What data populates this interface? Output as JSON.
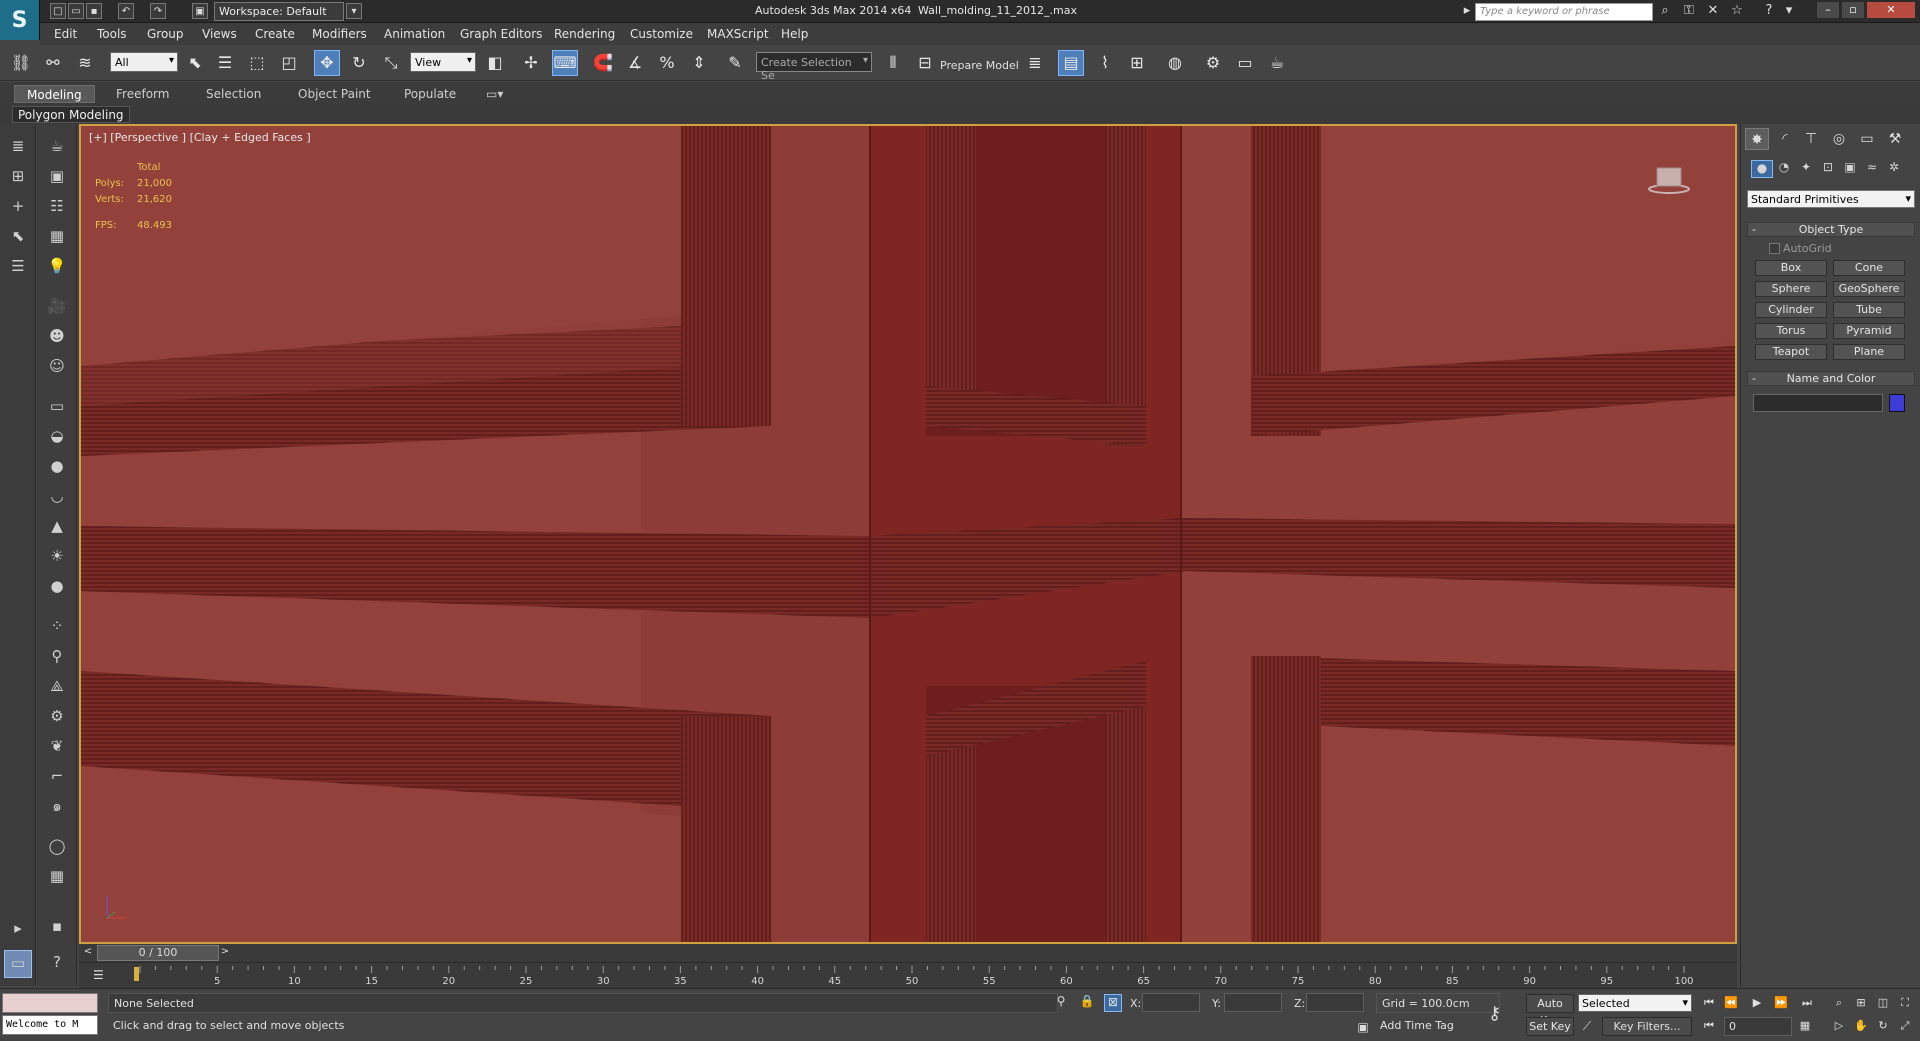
{
  "app": {
    "logo_glyph": "S",
    "title": "Autodesk 3ds Max  2014 x64",
    "file": "Wall_molding_11_2012_.max",
    "workspace_label": "Workspace: Default",
    "search_placeholder": "Type a keyword or phrase"
  },
  "menu": [
    "Edit",
    "Tools",
    "Group",
    "Views",
    "Create",
    "Modifiers",
    "Animation",
    "Graph Editors",
    "Rendering",
    "Customize",
    "MAXScript",
    "Help"
  ],
  "toolbar": {
    "selection_filter": "All",
    "ref_coord": "View",
    "selection_set_placeholder": "Create Selection Se",
    "prepare_model": "Prepare Model"
  },
  "ribbon": {
    "tabs": [
      "Modeling",
      "Freeform",
      "Selection",
      "Object Paint",
      "Populate"
    ],
    "active_tab": "Modeling",
    "sub_label": "Polygon Modeling"
  },
  "viewport": {
    "label": "[+] [Perspective ] [Clay + Edged Faces ]",
    "stats": {
      "total_label": "Total",
      "polys_label": "Polys:",
      "polys": "21,000",
      "verts_label": "Verts:",
      "verts": "21,620",
      "fps_label": "FPS:",
      "fps": "48.493"
    },
    "colors": {
      "wall": "#8e3c37",
      "wall_light": "#9b4a43",
      "molding_dark": "#5a1d1c",
      "corner": "#7a2420"
    }
  },
  "command_panel": {
    "category": "Standard Primitives",
    "object_type_title": "Object Type",
    "autogrid": "AutoGrid",
    "primitives": [
      "Box",
      "Cone",
      "Sphere",
      "GeoSphere",
      "Cylinder",
      "Tube",
      "Torus",
      "Pyramid",
      "Teapot",
      "Plane"
    ],
    "name_color_title": "Name and Color",
    "object_color": "#3c3cd6"
  },
  "timeline": {
    "position": "0 / 100",
    "ticks": [
      "5",
      "10",
      "15",
      "20",
      "25",
      "30",
      "35",
      "40",
      "45",
      "50",
      "55",
      "60",
      "65",
      "70",
      "75",
      "80",
      "85",
      "90",
      "95",
      "100"
    ]
  },
  "status": {
    "maxscript_output": "Welcome to M",
    "selection": "None Selected",
    "prompt": "Click and drag to select and move objects",
    "x_label": "X:",
    "y_label": "Y:",
    "z_label": "Z:",
    "grid": "Grid = 100.0cm",
    "add_time_tag": "Add Time Tag",
    "auto_key": "Auto Key",
    "set_key": "Set Key",
    "key_mode": "Selected",
    "key_filters": "Key Filters...",
    "current_frame": "0"
  }
}
